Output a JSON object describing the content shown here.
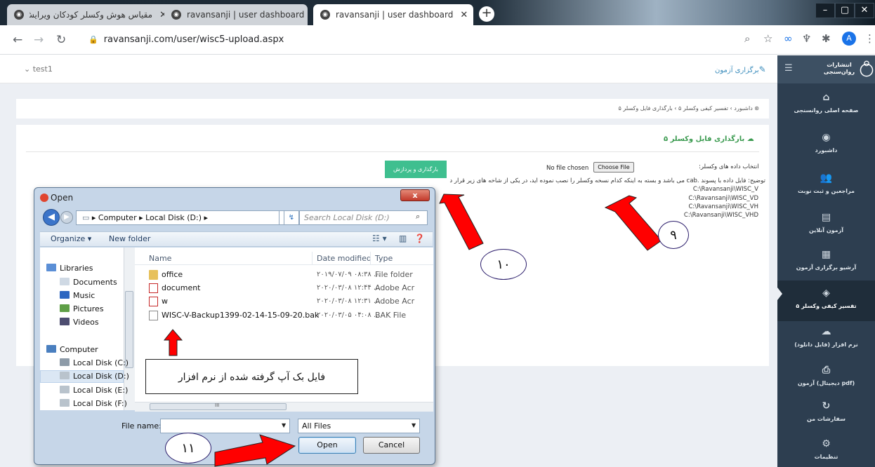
{
  "browser": {
    "tabs": [
      {
        "label": "مقیاس هوش وکسلر کودکان ویرایش پنجم",
        "active": false
      },
      {
        "label": "ravansanji | user dashboard",
        "active": false
      },
      {
        "label": "ravansanji | user dashboard",
        "active": true
      }
    ],
    "url": "ravansanji.com/user/wisc5-upload.aspx",
    "avatar_letter": "A"
  },
  "header": {
    "user_menu": "test1",
    "exam_link": "برگزاری آزمون"
  },
  "breadcrumb": "داشبورد  ›  تفسیر کیفی وکسلر ۵  ›  بارگذاری فایل وکسلر ۵",
  "panel": {
    "title": "بارگذاری فایل وکسلر ۵",
    "process_button": "بارگذاری و پردازش",
    "choose_label": "انتخاب داده های وکسلر:",
    "no_file": "No file chosen",
    "choose_button": "Choose File",
    "description": "توضیح: فایل داده با پسوند .cab می باشد و بسته به اینکه کدام نسخه وکسلر را نصب نموده اید، در یکی از شاخه های زیر قرار دارد",
    "paths": [
      "C:\\Ravansanji\\WISC_V",
      "C:\\Ravansanji\\WISC_VD",
      "C:\\Ravansanji\\WISC_VH",
      "C:\\Ravansanji\\WISC_VHD"
    ]
  },
  "sidebar": {
    "brand": "انتشارات روان‌سنجی",
    "items": [
      {
        "label": "صفحه اصلی روانسنجی",
        "icon": "home-icon",
        "glyph": "⌂"
      },
      {
        "label": "داشبورد",
        "icon": "dashboard-icon",
        "glyph": "◉"
      },
      {
        "label": "مراجعین و ثبت نوبت",
        "icon": "users-icon",
        "glyph": "👥"
      },
      {
        "label": "آزمون آنلاین",
        "icon": "document-icon",
        "glyph": "▤"
      },
      {
        "label": "آرشیو برگزاری آزمون",
        "icon": "archive-icon",
        "glyph": "▦"
      },
      {
        "label": "تفسیر کیفی وکسلر ۵",
        "icon": "cube-icon",
        "glyph": "◈"
      },
      {
        "label": "نرم افزار (فایل دانلود)",
        "icon": "cloud-upload-icon",
        "glyph": "☁"
      },
      {
        "label": "آزمون (دیجیتال pdf)",
        "icon": "pdf-icon",
        "glyph": "⎙"
      },
      {
        "label": "سفارشات من",
        "icon": "history-icon",
        "glyph": "↻"
      },
      {
        "label": "تنظیمات",
        "icon": "gears-icon",
        "glyph": "⚙"
      }
    ],
    "active_index": 5
  },
  "dialog": {
    "title": "Open",
    "close_label": "x",
    "path": "▸ Computer ▸ Local Disk (D:) ▸",
    "search_placeholder": "Search Local Disk (D:)",
    "organize": "Organize ▾",
    "new_folder": "New folder",
    "nav": [
      {
        "label": "Libraries",
        "type": "group",
        "color": "#5b8fd6"
      },
      {
        "label": "Documents",
        "type": "child",
        "color": "#cfd9e4"
      },
      {
        "label": "Music",
        "type": "child",
        "color": "#2c66c1"
      },
      {
        "label": "Pictures",
        "type": "child",
        "color": "#5f9f47"
      },
      {
        "label": "Videos",
        "type": "child",
        "color": "#4d4d70"
      },
      {
        "label": "Computer",
        "type": "group",
        "color": "#4a7fbf"
      },
      {
        "label": "Local Disk (C:)",
        "type": "child",
        "color": "#8d9ba8"
      },
      {
        "label": "Local Disk (D:)",
        "type": "child",
        "color": "#b9c3cc",
        "selected": true
      },
      {
        "label": "Local Disk (E:)",
        "type": "child",
        "color": "#b9c3cc"
      },
      {
        "label": "Local Disk (F:)",
        "type": "child",
        "color": "#b9c3cc"
      }
    ],
    "columns": {
      "name": "Name",
      "date": "Date modified",
      "type": "Type"
    },
    "files": [
      {
        "name": "office",
        "date": "۲۰۱۹/۰۷/۰۹ ۰۸:۳۸ ...",
        "type": "File folder",
        "kind": "folder"
      },
      {
        "name": "document",
        "date": "۲۰۲۰/۰۳/۰۸ ۱۲:۴۴ ...",
        "type": "Adobe Acr",
        "kind": "pdf"
      },
      {
        "name": "w",
        "date": "۲۰۲۰/۰۳/۰۸ ۱۲:۳۱ ...",
        "type": "Adobe Acr",
        "kind": "pdf"
      },
      {
        "name": "WISC-V-Backup1399-02-14-15-09-20.bak",
        "date": "۲۰۲۰/۰۳/۰۵ ۰۴:۰۸ ...",
        "type": "BAK File",
        "kind": "file"
      }
    ],
    "scroll_label": "III",
    "filename_label": "File name:",
    "filename_value": "",
    "filetype": "All Files",
    "open_button": "Open",
    "cancel_button": "Cancel"
  },
  "annotations": {
    "step9": "۹",
    "step10": "۱۰",
    "step11": "۱۱",
    "note": "فایل بک آپ گرفته شده از نرم افزار",
    "arrow_color": "#ff0000"
  }
}
